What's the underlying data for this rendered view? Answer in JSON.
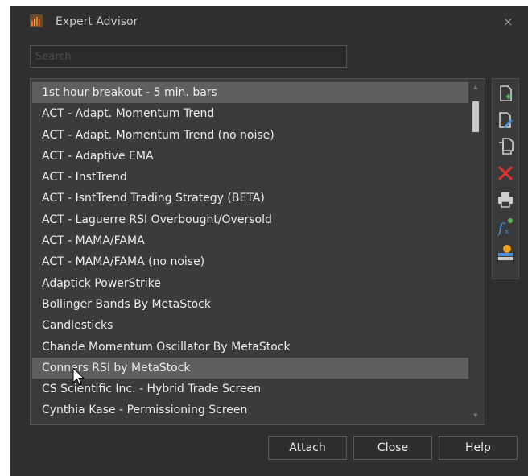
{
  "window": {
    "title": "Expert Advisor",
    "close_glyph": "×"
  },
  "search": {
    "placeholder": "Search",
    "value": ""
  },
  "list": {
    "items": [
      "1st hour breakout - 5 min. bars",
      "ACT - Adapt. Momentum Trend",
      "ACT - Adapt. Momentum Trend (no noise)",
      "ACT - Adaptive EMA",
      "ACT - InstTrend",
      "ACT - IsntTrend Trading Strategy (BETA)",
      "ACT - Laguerre RSI Overbought/Oversold",
      "ACT - MAMA/FAMA",
      "ACT - MAMA/FAMA (no noise)",
      "Adaptick PowerStrike",
      "Bollinger Bands By MetaStock",
      "Candlesticks",
      "Chande Momentum Oscillator By MetaStock",
      "Conners RSI by MetaStock",
      "CS Scientific Inc. - Hybrid Trade Screen",
      "Cynthia Kase - Permissioning Screen"
    ],
    "highlighted": [
      "1st hour breakout - 5 min. bars",
      "Conners RSI by MetaStock"
    ]
  },
  "toolbar": {
    "icons": [
      "new-icon",
      "edit-icon",
      "copy-icon",
      "delete-icon",
      "print-icon",
      "formula-icon",
      "organizer-icon"
    ],
    "colors": {
      "green": "#5cb85c",
      "red": "#e03030",
      "orange": "#f0a020",
      "blue": "#4a90d9",
      "gray": "#cfcfcf"
    }
  },
  "buttons": {
    "attach": "Attach",
    "close": "Close",
    "help": "Help"
  },
  "theme": {
    "dialog_bg": "#2f2f2f",
    "list_bg": "#3b3b3b",
    "selected_bg": "#5f5f5f",
    "text": "#ececec"
  }
}
